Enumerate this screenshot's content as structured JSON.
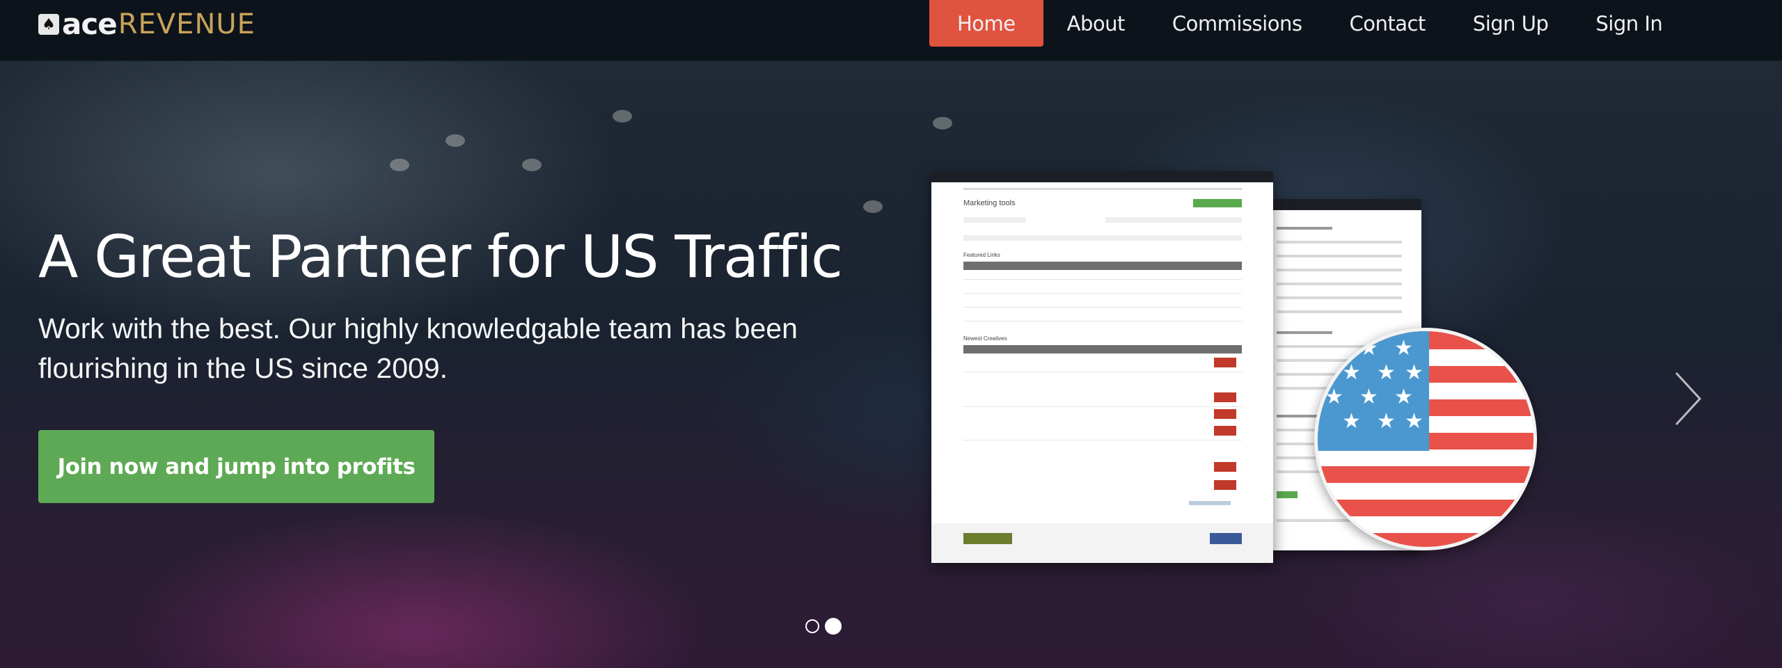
{
  "brand": {
    "logo_icon": "spade-icon",
    "ace": "ace",
    "revenue": "REVENUE",
    "accent": "#c9a35a"
  },
  "nav": {
    "items": [
      {
        "label": "Home",
        "active": true
      },
      {
        "label": "About"
      },
      {
        "label": "Commissions"
      },
      {
        "label": "Contact"
      },
      {
        "label": "Sign Up"
      },
      {
        "label": "Sign In"
      }
    ],
    "active_color": "#e0533f"
  },
  "hero": {
    "title": "A Great Partner for US Traffic",
    "subtitle": "Work with the best. Our highly knowledgable team has been flourishing in the US since 2009.",
    "cta_label": "Join now and jump into profits",
    "cta_color": "#5ea955"
  },
  "mockup": {
    "section_title": "Marketing tools",
    "featured": "Featured Links",
    "newest": "Newest Creatives"
  },
  "carousel": {
    "next_icon": "chevron-right-icon",
    "slides": 2,
    "active_slide": 2
  }
}
